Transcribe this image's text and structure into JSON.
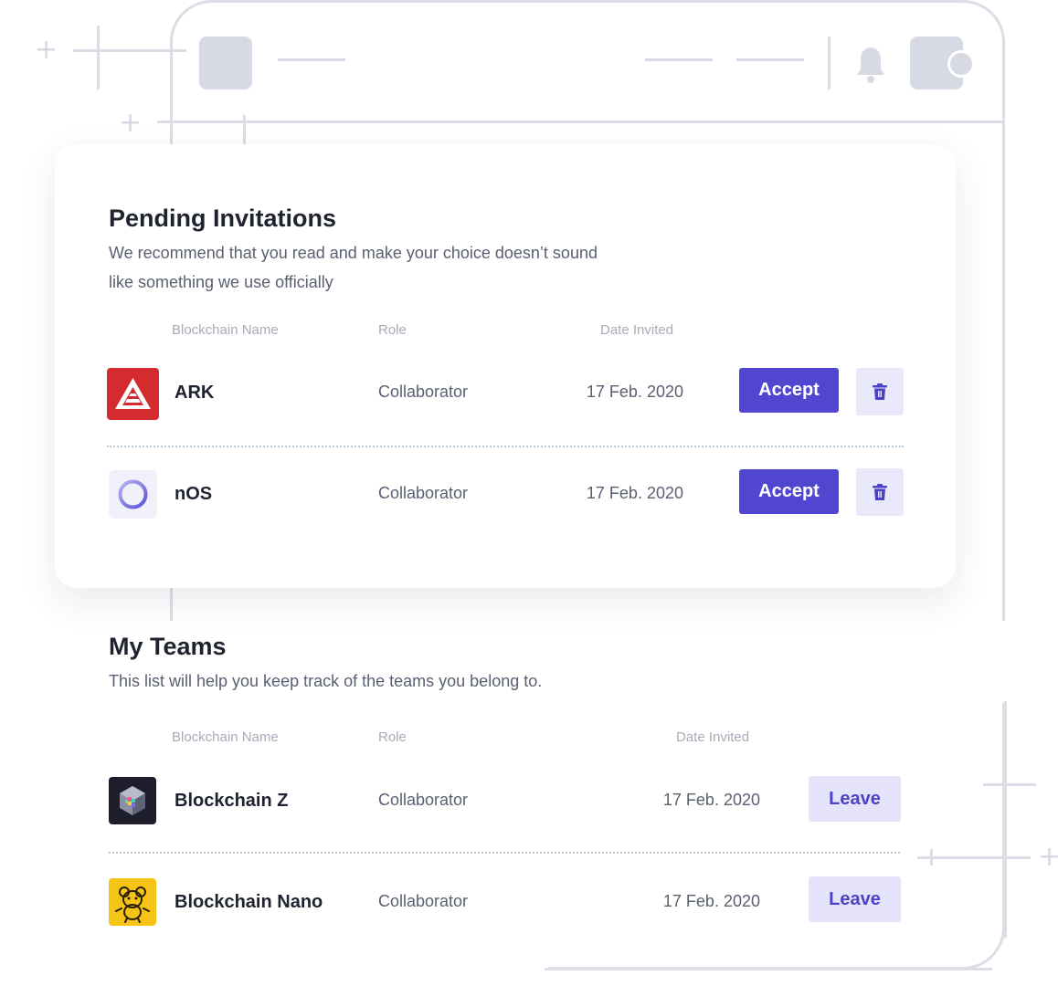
{
  "pending": {
    "title": "Pending Invitations",
    "subtitle_line1": "We recommend that you read and make your choice doesn’t sound",
    "subtitle_line2": "like something we use officially",
    "columns": {
      "name": "Blockchain Name",
      "role": "Role",
      "date": "Date Invited"
    },
    "rows": [
      {
        "name": "ARK",
        "role": "Collaborator",
        "date": "17 Feb. 2020",
        "accept_label": "Accept",
        "logo_icon": "ark-logo-icon"
      },
      {
        "name": "nOS",
        "role": "Collaborator",
        "date": "17 Feb. 2020",
        "accept_label": "Accept",
        "logo_icon": "nos-logo-icon"
      }
    ]
  },
  "teams": {
    "title": "My Teams",
    "subtitle": "This list will help you keep track of the teams you belong to.",
    "columns": {
      "name": "Blockchain Name",
      "role": "Role",
      "date": "Date Invited"
    },
    "rows": [
      {
        "name": "Blockchain Z",
        "role": "Collaborator",
        "date": "17 Feb. 2020",
        "leave_label": "Leave",
        "logo_icon": "blockchain-z-logo-icon"
      },
      {
        "name": "Blockchain Nano",
        "role": "Collaborator",
        "date": "17 Feb. 2020",
        "leave_label": "Leave",
        "logo_icon": "blockchain-nano-logo-icon"
      }
    ]
  },
  "colors": {
    "accent": "#5046cf",
    "accent_soft": "#eae9fb",
    "ark_red": "#d42b30",
    "nano_yellow": "#f6c414"
  }
}
